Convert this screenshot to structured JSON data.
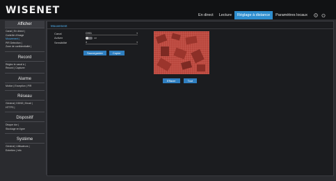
{
  "app": {
    "logo": "WISENET"
  },
  "topnav": {
    "items": [
      {
        "label": "En direct",
        "active": false
      },
      {
        "label": "Lecture",
        "active": false
      },
      {
        "label": "Réglage à distance",
        "active": true
      },
      {
        "label": "Paramètres locaux",
        "active": false
      }
    ],
    "icons": [
      "info-icon",
      "power-icon"
    ]
  },
  "sidebar": {
    "sections": [
      {
        "title": "Afficher",
        "current": true,
        "lines": [
          {
            "text": "Canal | En direct |",
            "selected": false
          },
          {
            "text": "Contrôle d'image",
            "selected": false
          },
          {
            "text": "Mouvement |",
            "selected": true
          },
          {
            "text": "PIR Detection |",
            "selected": false
          },
          {
            "text": "Zone de confidentialité |",
            "selected": false
          }
        ]
      },
      {
        "title": "Record",
        "current": false,
        "lines": [
          {
            "text": "Réglez le canal à |",
            "selected": false
          },
          {
            "text": "Record | Capturer",
            "selected": false
          }
        ]
      },
      {
        "title": "Alarme",
        "current": false,
        "lines": [
          {
            "text": "Motion | Exception | PIR",
            "selected": false
          }
        ]
      },
      {
        "title": "Réseau",
        "current": false,
        "lines": [
          {
            "text": "Général | DDNS | Email |",
            "selected": false
          },
          {
            "text": "HTTPS |",
            "selected": false
          }
        ]
      },
      {
        "title": "Dispositif",
        "current": false,
        "lines": [
          {
            "text": "Disque dur |",
            "selected": false
          },
          {
            "text": "Stockage en ligne",
            "selected": false
          }
        ]
      },
      {
        "title": "Système",
        "current": false,
        "lines": [
          {
            "text": "Général | Utilisateurs |",
            "selected": false
          },
          {
            "text": "Entretien | Info",
            "selected": false
          }
        ]
      }
    ]
  },
  "main": {
    "tab": "Mouvement",
    "form": {
      "channel_label": "Canal",
      "channel_value": "CH01",
      "enable_label": "Activer",
      "enable_value": "Off",
      "sensitivity_label": "Sensibilité",
      "sensitivity_value": "4"
    },
    "buttons": {
      "save": "Sauvegarder",
      "copy": "Copier"
    },
    "video_buttons": {
      "clear": "Effacer",
      "all": "Tout"
    }
  },
  "colors": {
    "accent": "#2f8ecf",
    "video_tint": "#c44a3e",
    "background": "#2a2b2f"
  }
}
